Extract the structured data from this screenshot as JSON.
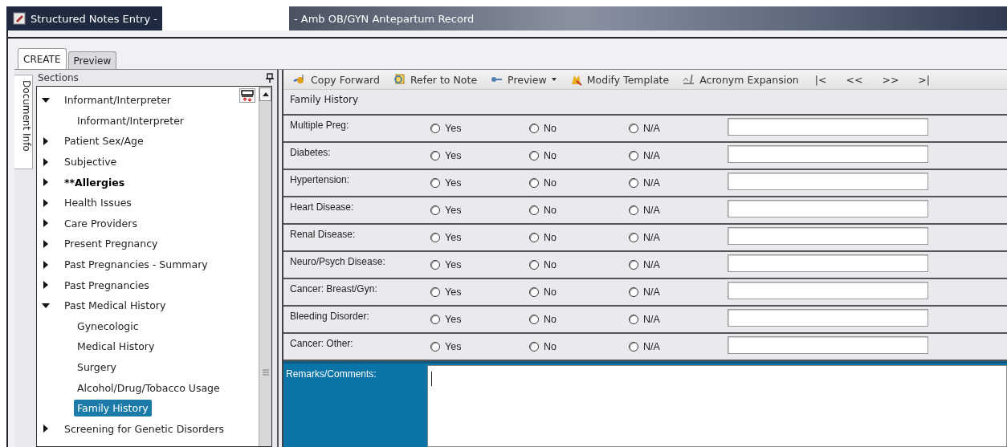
{
  "window": {
    "title_left": "Structured Notes Entry -",
    "title_right": "- Amb OB/GYN Antepartum Record"
  },
  "tabs": [
    {
      "label": "CREATE",
      "selected": true
    },
    {
      "label": "Preview",
      "selected": false
    }
  ],
  "side_tab": {
    "label": "Document Info"
  },
  "sections": {
    "title": "Sections",
    "items": [
      {
        "label": "Informant/Interpreter",
        "expanded": true,
        "bold": false,
        "selected": false,
        "children": [
          {
            "label": "Informant/Interpreter",
            "selected": false
          }
        ]
      },
      {
        "label": "Patient Sex/Age",
        "expanded": false,
        "bold": false,
        "selected": false
      },
      {
        "label": "Subjective",
        "expanded": false,
        "bold": false,
        "selected": false
      },
      {
        "label": "**Allergies",
        "expanded": false,
        "bold": true,
        "selected": false
      },
      {
        "label": "Health Issues",
        "expanded": false,
        "bold": false,
        "selected": false
      },
      {
        "label": "Care Providers",
        "expanded": false,
        "bold": false,
        "selected": false
      },
      {
        "label": "Present Pregnancy",
        "expanded": false,
        "bold": false,
        "selected": false
      },
      {
        "label": "Past Pregnancies - Summary",
        "expanded": false,
        "bold": false,
        "selected": false
      },
      {
        "label": "Past Pregnancies",
        "expanded": false,
        "bold": false,
        "selected": false
      },
      {
        "label": "Past Medical History",
        "expanded": true,
        "bold": false,
        "selected": false,
        "children": [
          {
            "label": "Gynecologic",
            "selected": false
          },
          {
            "label": "Medical History",
            "selected": false
          },
          {
            "label": "Surgery",
            "selected": false
          },
          {
            "label": "Alcohol/Drug/Tobacco Usage",
            "selected": false
          },
          {
            "label": "Family History",
            "selected": true
          }
        ]
      },
      {
        "label": "Screening for Genetic Disorders",
        "expanded": false,
        "bold": false,
        "selected": false
      }
    ]
  },
  "toolbar": [
    {
      "kind": "copy",
      "label": "Copy Forward"
    },
    {
      "kind": "refer",
      "label": "Refer to Note"
    },
    {
      "kind": "preview",
      "label": "Preview",
      "dropdown": true
    },
    {
      "kind": "modify",
      "label": "Modify Template"
    },
    {
      "kind": "acronym",
      "label": "Acronym Expansion"
    },
    {
      "kind": "nav",
      "label": "|<"
    },
    {
      "kind": "nav",
      "label": "<<"
    },
    {
      "kind": "nav",
      "label": ">>"
    },
    {
      "kind": "nav",
      "label": ">|"
    }
  ],
  "form": {
    "title": "Family History",
    "rows": [
      {
        "label": "Multiple Preg:",
        "options": [
          {
            "label": "Yes",
            "selected": false
          },
          {
            "label": "No",
            "selected": false
          },
          {
            "label": "N/A",
            "selected": false
          }
        ]
      },
      {
        "label": "Diabetes:",
        "options": [
          {
            "label": "Yes",
            "selected": false
          },
          {
            "label": "No",
            "selected": false
          },
          {
            "label": "N/A",
            "selected": false
          }
        ]
      },
      {
        "label": "Hypertension:",
        "options": [
          {
            "label": "Yes",
            "selected": false
          },
          {
            "label": "No",
            "selected": false
          },
          {
            "label": "N/A",
            "selected": false
          }
        ]
      },
      {
        "label": "Heart Disease:",
        "options": [
          {
            "label": "Yes",
            "selected": false
          },
          {
            "label": "No",
            "selected": false
          },
          {
            "label": "N/A",
            "selected": false
          }
        ]
      },
      {
        "label": "Renal Disease:",
        "options": [
          {
            "label": "Yes",
            "selected": false
          },
          {
            "label": "No",
            "selected": false
          },
          {
            "label": "N/A",
            "selected": false
          }
        ]
      },
      {
        "label": "Neuro/Psych Disease:",
        "options": [
          {
            "label": "Yes",
            "selected": false
          },
          {
            "label": "No",
            "selected": false
          },
          {
            "label": "N/A",
            "selected": false
          }
        ]
      },
      {
        "label": "Cancer: Breast/Gyn:",
        "options": [
          {
            "label": "Yes",
            "selected": false
          },
          {
            "label": "No",
            "selected": false
          },
          {
            "label": "N/A",
            "selected": false
          }
        ]
      },
      {
        "label": "Bleeding Disorder:",
        "options": [
          {
            "label": "Yes",
            "selected": false
          },
          {
            "label": "No",
            "selected": false
          },
          {
            "label": "N/A",
            "selected": false
          }
        ]
      },
      {
        "label": "Cancer: Other:",
        "options": [
          {
            "label": "Yes",
            "selected": false
          },
          {
            "label": "No",
            "selected": false
          },
          {
            "label": "N/A",
            "selected": false
          }
        ]
      }
    ],
    "remarks": {
      "label": "Remarks/Comments:"
    }
  }
}
